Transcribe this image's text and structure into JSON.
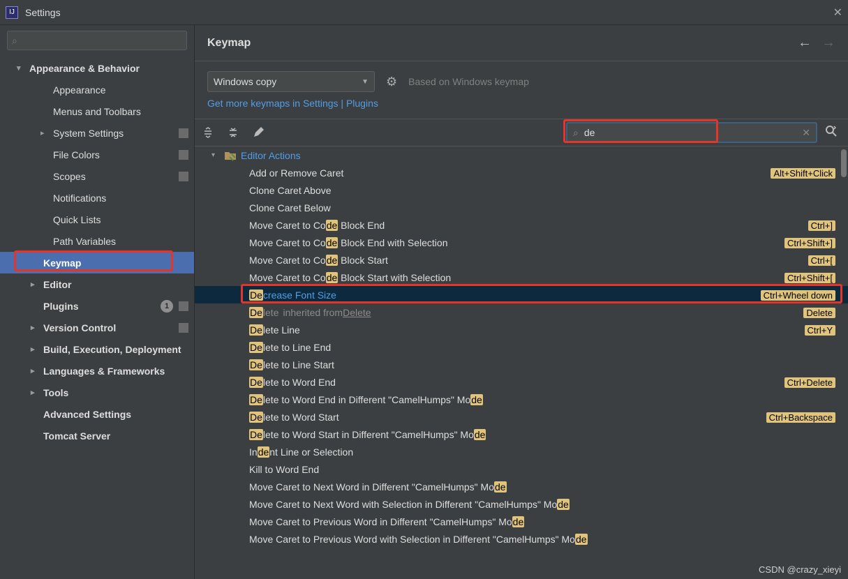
{
  "titlebar": {
    "title": "Settings"
  },
  "main": {
    "heading": "Keymap",
    "keymap_selected": "Windows copy",
    "based_on": "Based on Windows keymap",
    "get_more": "Get more keymaps in Settings | Plugins",
    "search_value": "de"
  },
  "sidebar": {
    "items": [
      {
        "label": "Appearance & Behavior",
        "depth": 0,
        "chev": "down",
        "bold": true
      },
      {
        "label": "Appearance",
        "depth": 2
      },
      {
        "label": "Menus and Toolbars",
        "depth": 2
      },
      {
        "label": "System Settings",
        "depth": 2,
        "chev": "right",
        "tag": true
      },
      {
        "label": "File Colors",
        "depth": 2,
        "tag": true
      },
      {
        "label": "Scopes",
        "depth": 2,
        "tag": true
      },
      {
        "label": "Notifications",
        "depth": 2
      },
      {
        "label": "Quick Lists",
        "depth": 2
      },
      {
        "label": "Path Variables",
        "depth": 2
      },
      {
        "label": "Keymap",
        "depth": 1,
        "bold": true,
        "selected": true
      },
      {
        "label": "Editor",
        "depth": 1,
        "chev": "right",
        "bold": true
      },
      {
        "label": "Plugins",
        "depth": 1,
        "bold": true,
        "badge": "1",
        "tag": true
      },
      {
        "label": "Version Control",
        "depth": 1,
        "chev": "right",
        "bold": true,
        "tag": true
      },
      {
        "label": "Build, Execution, Deployment",
        "depth": 1,
        "chev": "right",
        "bold": true
      },
      {
        "label": "Languages & Frameworks",
        "depth": 1,
        "chev": "right",
        "bold": true
      },
      {
        "label": "Tools",
        "depth": 1,
        "chev": "right",
        "bold": true
      },
      {
        "label": "Advanced Settings",
        "depth": 1,
        "bold": true
      },
      {
        "label": "Tomcat Server",
        "depth": 1,
        "bold": true
      }
    ]
  },
  "tree": {
    "group": "Editor Actions",
    "actions": [
      {
        "label": "Add or Remove Caret",
        "shortcut": "Alt+Shift+Click"
      },
      {
        "label": "Clone Caret Above"
      },
      {
        "label": "Clone Caret Below"
      },
      {
        "label": "Move Caret to Co|de| Block End",
        "shortcut": "Ctrl+]"
      },
      {
        "label": "Move Caret to Co|de| Block End with Selection",
        "shortcut": "Ctrl+Shift+]"
      },
      {
        "label": "Move Caret to Co|de| Block Start",
        "shortcut": "Ctrl+["
      },
      {
        "label": "Move Caret to Co|de| Block Start with Selection",
        "shortcut": "Ctrl+Shift+["
      },
      {
        "label": "|De|crease Font Size",
        "shortcut": "Ctrl+Wheel down",
        "selected": true
      },
      {
        "label": "|De|lete",
        "inherited": "inherited from",
        "inh_link": "Delete",
        "shortcut": "Delete",
        "dim": true
      },
      {
        "label": "|De|lete Line",
        "shortcut": "Ctrl+Y"
      },
      {
        "label": "|De|lete to Line End"
      },
      {
        "label": "|De|lete to Line Start"
      },
      {
        "label": "|De|lete to Word End",
        "shortcut": "Ctrl+Delete"
      },
      {
        "label": "|De|lete to Word End in Different \"CamelHumps\" Mo|de|"
      },
      {
        "label": "|De|lete to Word Start",
        "shortcut": "Ctrl+Backspace"
      },
      {
        "label": "|De|lete to Word Start in Different \"CamelHumps\" Mo|de|"
      },
      {
        "label": "In|de|nt Line or Selection"
      },
      {
        "label": "Kill to Word End"
      },
      {
        "label": "Move Caret to Next Word in Different \"CamelHumps\" Mo|de|"
      },
      {
        "label": "Move Caret to Next Word with Selection in Different \"CamelHumps\" Mo|de|"
      },
      {
        "label": "Move Caret to Previous Word in Different \"CamelHumps\" Mo|de|"
      },
      {
        "label": "Move Caret to Previous Word with Selection in Different \"CamelHumps\" Mo|de|"
      }
    ]
  },
  "watermark": "CSDN @crazy_xieyi"
}
